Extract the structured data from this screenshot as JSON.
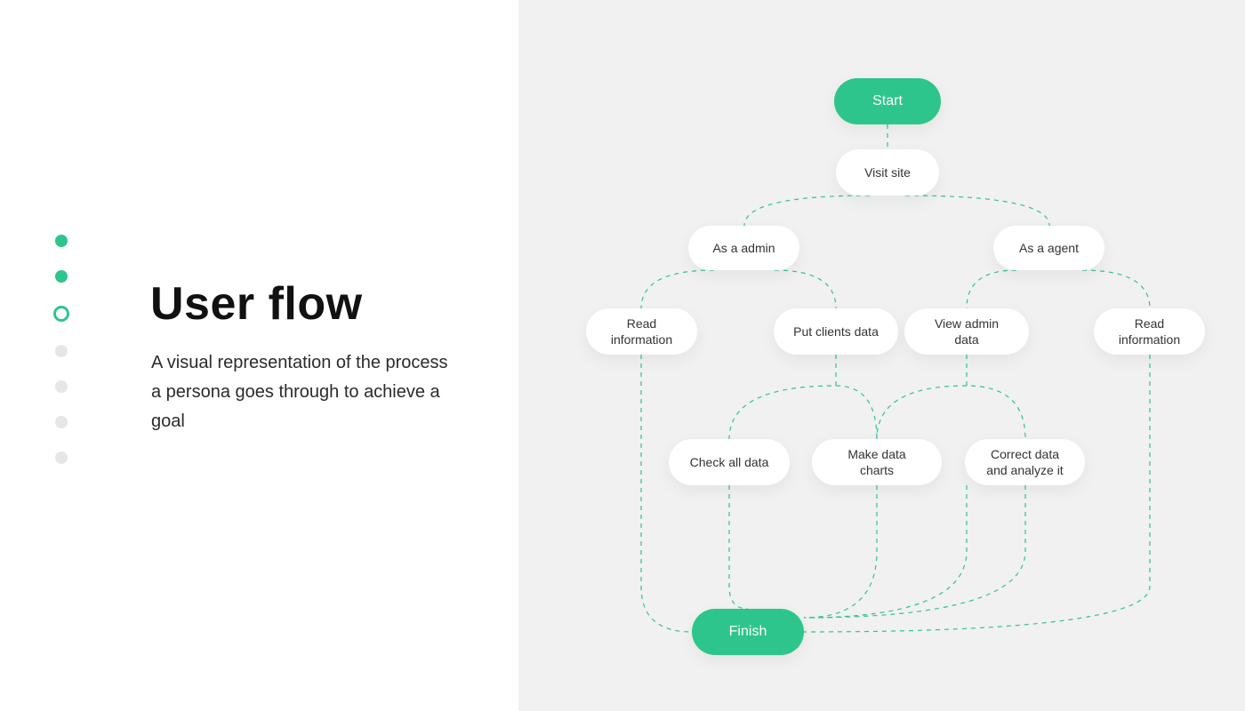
{
  "colors": {
    "accent": "#2ec58c",
    "panel_bg": "#f1f1f1"
  },
  "left": {
    "title": "User flow",
    "subtitle": "A visual representation of the process a persona  goes through to achieve a goal",
    "dots": [
      {
        "kind": "filled"
      },
      {
        "kind": "filled"
      },
      {
        "kind": "ring"
      },
      {
        "kind": "inactive"
      },
      {
        "kind": "inactive"
      },
      {
        "kind": "inactive"
      },
      {
        "kind": "inactive"
      }
    ]
  },
  "flow": {
    "start": "Start",
    "visit": "Visit site",
    "admin": "As a admin",
    "agent": "As a agent",
    "read_left": "Read\ninformation",
    "put": "Put clients data",
    "view": "View admin data",
    "read_right": "Read\ninformation",
    "check": "Check all data",
    "charts": "Make data charts",
    "correct": "Correct data\nand analyze it",
    "finish": "Finish"
  }
}
